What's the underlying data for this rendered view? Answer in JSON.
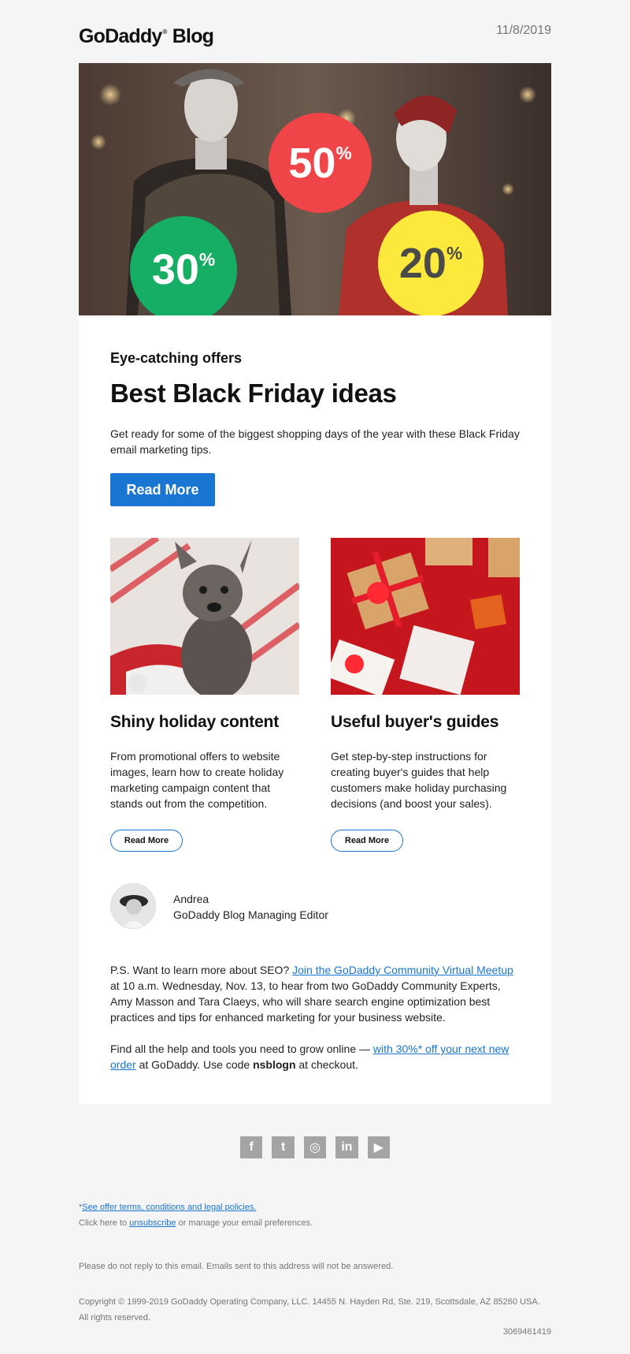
{
  "header": {
    "logo_text": "GoDaddy",
    "logo_blog": "Blog",
    "date": "11/8/2019"
  },
  "hero": {
    "badges": [
      {
        "value": "50",
        "unit": "%",
        "color": "#ef4448"
      },
      {
        "value": "30",
        "unit": "%",
        "color": "#16ae64"
      },
      {
        "value": "20",
        "unit": "%",
        "color": "#fde93b"
      }
    ]
  },
  "main": {
    "eyebrow": "Eye-catching offers",
    "headline": "Best Black Friday ideas",
    "intro": "Get ready for some of the biggest shopping days of the year with these Black Friday email marketing tips.",
    "read_more": "Read More"
  },
  "articles": [
    {
      "title": "Shiny holiday content",
      "text": "From promotional offers to website images, learn how to create holiday marketing campaign content that stands out from the competition.",
      "button": "Read More"
    },
    {
      "title": "Useful buyer's guides",
      "text": "Get step-by-step instructions for creating buyer's guides that help customers make holiday purchasing decisions (and boost your sales).",
      "button": "Read More"
    }
  ],
  "author": {
    "name": "Andrea",
    "role": "GoDaddy Blog Managing Editor"
  },
  "ps": {
    "prefix": "P.S. Want to learn more about SEO? ",
    "link": "Join the GoDaddy Community Virtual Meetup",
    "suffix": " at 10 a.m. Wednesday, Nov. 13, to hear from two GoDaddy Community Experts, Amy Masson and Tara Claeys, who will share search engine optimization best practices and tips for enhanced marketing for your business website."
  },
  "grow": {
    "prefix": "Find all the help and tools you need to grow online — ",
    "link": "with 30%* off your next new order",
    "middle": " at GoDaddy. Use code ",
    "code": "nsblogn",
    "suffix": " at checkout."
  },
  "social": [
    {
      "icon": "facebook-icon",
      "glyph": "f"
    },
    {
      "icon": "twitter-icon",
      "glyph": "t"
    },
    {
      "icon": "instagram-icon",
      "glyph": "◎"
    },
    {
      "icon": "linkedin-icon",
      "glyph": "in"
    },
    {
      "icon": "youtube-icon",
      "glyph": "▶"
    }
  ],
  "footer": {
    "asterisk": "*",
    "terms_link": "See offer terms, conditions and legal policies.",
    "unsub_prefix": "Click here to ",
    "unsub_link": "unsubscribe",
    "unsub_suffix": " or manage your email preferences.",
    "noreply": "Please do not reply to this email. Emails sent to this address will not be answered.",
    "copyright": "Copyright © 1999-2019 GoDaddy Operating Company, LLC. 14455 N. Hayden Rd, Ste. 219, Scottsdale, AZ 85260 USA. All rights reserved.",
    "id": "3069461419"
  },
  "colors": {
    "accent": "#1976d2",
    "background": "#f5f5f5",
    "card": "#ffffff"
  }
}
